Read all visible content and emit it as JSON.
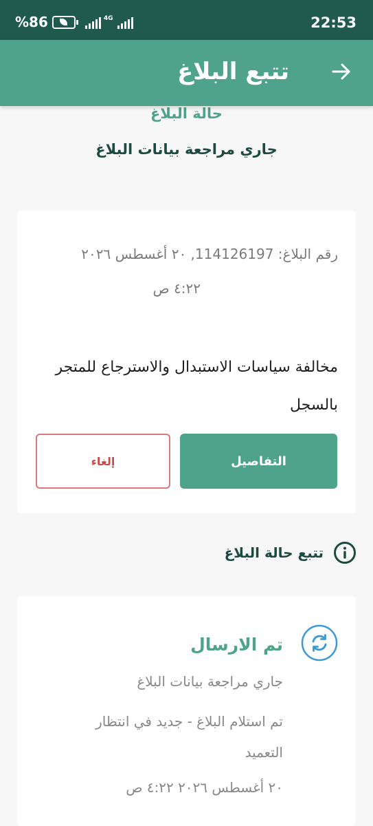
{
  "status_bar": {
    "battery": "%86",
    "network": "4G",
    "time": "22:53"
  },
  "app_bar": {
    "title": "تتبع البلاغ",
    "back_icon": "arrow-right-icon"
  },
  "report_status": {
    "label": "حالة البلاغ",
    "value": "جاري مراجعة بيانات البلاغ"
  },
  "report_card": {
    "meta_line1": "رقم البلاغ: 114126197, ٢٠ أغسطس ٢٠٢٦",
    "meta_line2": "٤:٢٢ ص",
    "reason_line1": "مخالفة سياسات الاستبدال والاسترجاع للمتجر",
    "reason_line2": "بالسجل",
    "details_label": "التفاصيل",
    "cancel_label": "إلغاء"
  },
  "tracking": {
    "title": "تتبع حالة البلاغ",
    "icon": "info-icon",
    "step": {
      "icon": "sync-icon",
      "title": "تم الارسال",
      "subtitle": "جاري مراجعة بيانات البلاغ",
      "description": "تم استلام البلاغ - جديد في انتظار التعميد",
      "date": "٢٠ أغسطس ٢٠٢٦ ٤:٢٢ ص"
    }
  },
  "colors": {
    "status_bar": "#1f5a4c",
    "app_bar": "#4fa38a",
    "primary": "#4fa38a",
    "dark_text": "#1d4a3e",
    "danger": "#c0504d",
    "sync_icon": "#3b9ad6"
  }
}
